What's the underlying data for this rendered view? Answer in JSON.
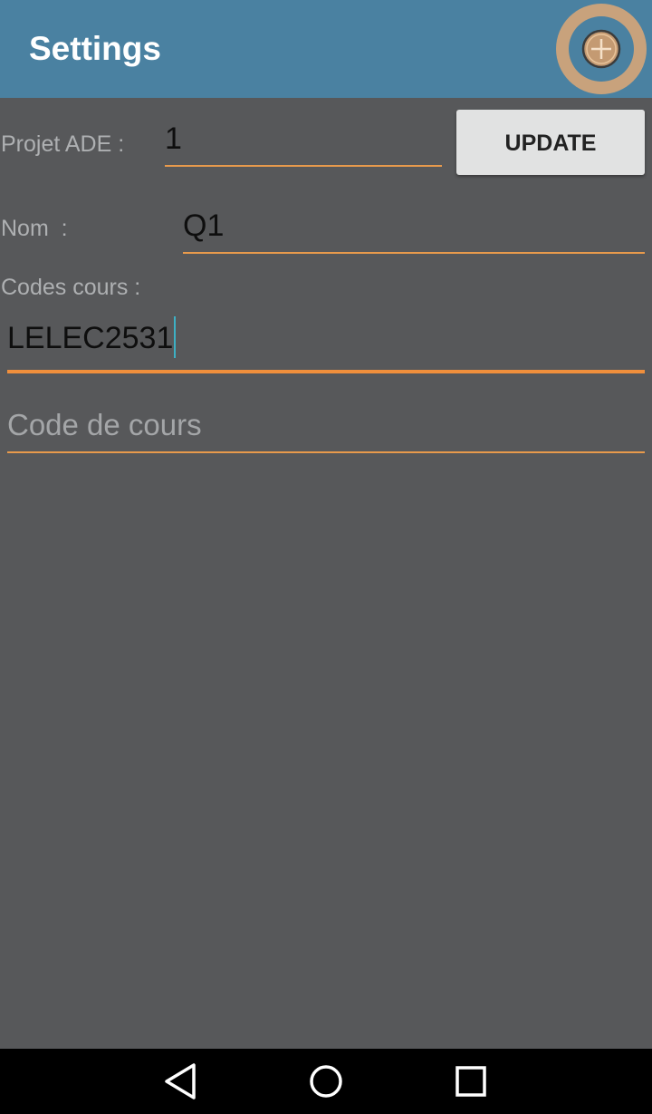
{
  "app_bar": {
    "title": "Settings",
    "add_button_icon": "add-circle-icon",
    "color": "#4a81a1"
  },
  "form": {
    "project": {
      "label": "Projet ADE :",
      "value": "1"
    },
    "update_button_label": "UPDATE",
    "name": {
      "label": "Nom  :",
      "value": "Q1"
    },
    "course_codes": {
      "label": "Codes cours :",
      "entries": [
        "LELEC2531"
      ],
      "new_entry_placeholder": "Code de cours"
    }
  },
  "colors": {
    "background": "#57585a",
    "accent": "#f08f3c",
    "cursor": "#3db0c4"
  },
  "nav_bar": {
    "icons": [
      "back-icon",
      "home-icon",
      "recents-icon"
    ]
  }
}
